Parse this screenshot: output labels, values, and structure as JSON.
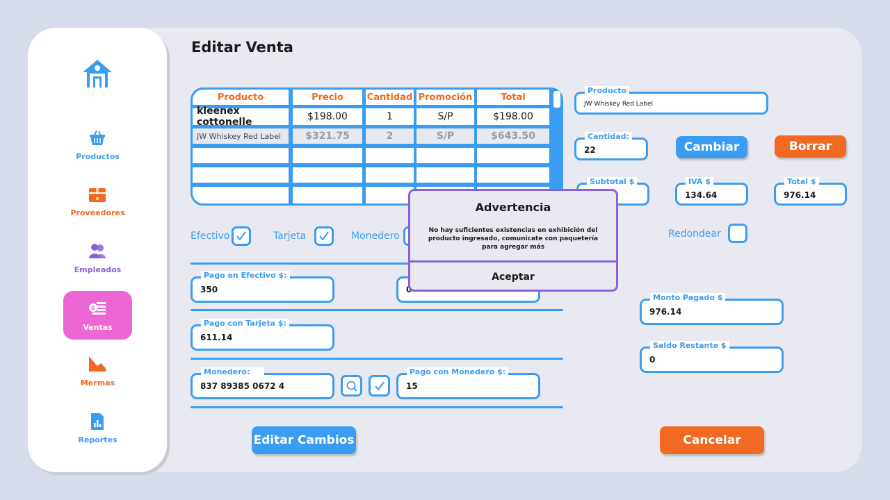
{
  "page": {
    "title": "Editar Venta"
  },
  "colors": {
    "accent_blue": "#3b9df2",
    "accent_orange": "#f26a22",
    "active_pink": "#ec67d4",
    "modal_border": "#8b5fd9",
    "purple": "#8b5fd9"
  },
  "sidebar": {
    "home_icon": "home-icon",
    "items": [
      {
        "label": "Productos",
        "icon": "basket-icon"
      },
      {
        "label": "Proveedores",
        "icon": "box-icon"
      },
      {
        "label": "Empleados",
        "icon": "users-icon"
      },
      {
        "label": "Ventas",
        "icon": "cash-icon",
        "active": true
      },
      {
        "label": "Mermas",
        "icon": "chart-down-icon"
      },
      {
        "label": "Reportes",
        "icon": "report-icon"
      }
    ]
  },
  "table": {
    "headers": [
      "Producto",
      "Precio",
      "Cantidad",
      "Promoción",
      "Total"
    ],
    "rows": [
      [
        "kleenex cottonelle",
        "$198.00",
        "1",
        "S/P",
        "$198.00"
      ],
      [
        "JW Whiskey Red Label",
        "$321.75",
        "2",
        "S/P",
        "$643.50"
      ]
    ]
  },
  "edit": {
    "producto_label": "Producto",
    "producto_value": "JW Whiskey Red Label",
    "cantidad_label": "Cantidad:",
    "cantidad_value": "22",
    "cambiar_label": "Cambiar",
    "borrar_label": "Borrar",
    "subtotal_label": "Subtotal $",
    "subtotal_value": "",
    "iva_label": "IVA $",
    "iva_value": "134.64",
    "total_label": "Total $",
    "total_value": "976.14"
  },
  "payment_methods": {
    "efectivo": "Efectivo",
    "tarjeta": "Tarjeta",
    "monedero": "Monedero",
    "redondear": "Redondear"
  },
  "payments": {
    "efectivo_label": "Pago en Efectivo $:",
    "efectivo_value": "350",
    "hidden_field_value": "0",
    "tarjeta_label": "Pago con Tarjeta $:",
    "tarjeta_value": "611.14",
    "monedero_label": "Monedero:",
    "monedero_value": "837 89385 0672 4",
    "pago_monedero_label": "Pago con Monedero $:",
    "pago_monedero_value": "15",
    "monto_pagado_label": "Monto Pagado $",
    "monto_pagado_value": "976.14",
    "saldo_label": "Saldo Restante $",
    "saldo_value": "0"
  },
  "actions": {
    "editar_label": "Editar Cambios",
    "cancelar_label": "Cancelar"
  },
  "modal": {
    "title": "Advertencia",
    "message": "No hay suficientes existencias en exhibición del producto ingresado, comunicate con paquetería para agregar más",
    "accept_label": "Aceptar"
  }
}
